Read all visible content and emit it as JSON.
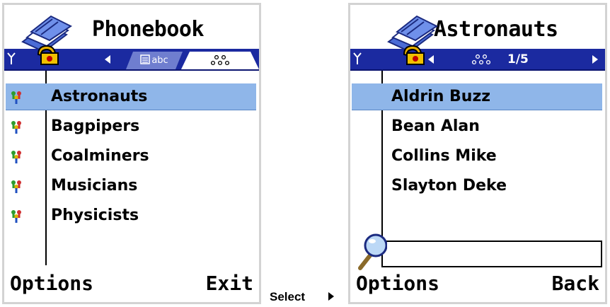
{
  "left_screen": {
    "title": "Phonebook",
    "tabs": [
      {
        "label": "abc",
        "icon": "cards-icon",
        "active": false
      },
      {
        "label": "",
        "icon": "group-icon",
        "active": true
      }
    ],
    "groups": [
      {
        "label": "Astronauts",
        "selected": true
      },
      {
        "label": "Bagpipers",
        "selected": false
      },
      {
        "label": "Coalminers",
        "selected": false
      },
      {
        "label": "Musicians",
        "selected": false
      },
      {
        "label": "Physicists",
        "selected": false
      }
    ],
    "softkeys": {
      "left": "Options",
      "right": "Exit"
    }
  },
  "caption": {
    "text": "Select"
  },
  "right_screen": {
    "title": "Astronauts",
    "counter": "1/5",
    "contacts": [
      {
        "label": "Aldrin Buzz",
        "selected": true
      },
      {
        "label": "Bean Alan",
        "selected": false
      },
      {
        "label": "Collins Mike",
        "selected": false
      },
      {
        "label": "Slayton Deke",
        "selected": false
      }
    ],
    "search": {
      "value": ""
    },
    "softkeys": {
      "left": "Options",
      "right": "Back"
    }
  },
  "colors": {
    "nav_bar": "#1b2aa0",
    "highlight": "#8fb6e9",
    "frame": "#d3d3d3"
  }
}
